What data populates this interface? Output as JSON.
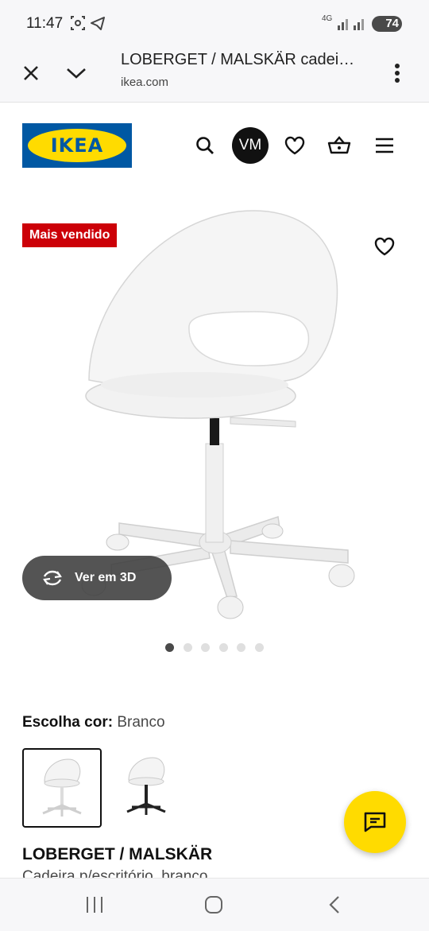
{
  "status_bar": {
    "time": "11:47",
    "network": "4G",
    "battery": "74"
  },
  "browser": {
    "title": "LOBERGET / MALSKÄR cadei…",
    "url": "ikea.com"
  },
  "header": {
    "logo_text": "IKEA",
    "avatar_initials": "VM"
  },
  "product": {
    "badge": "Mais vendido",
    "view_3d_label": "Ver em 3D",
    "gallery": {
      "total": 6,
      "active": 0
    },
    "color_label": "Escolha cor:",
    "color_value": "Branco",
    "swatches": [
      "Branco",
      "Preto"
    ],
    "name": "LOBERGET / MALSKÄR",
    "description": "Cadeira p/escritório, branco"
  },
  "colors": {
    "ikea_blue": "#0058a3",
    "ikea_yellow": "#ffdb00",
    "badge_red": "#cc0008"
  }
}
